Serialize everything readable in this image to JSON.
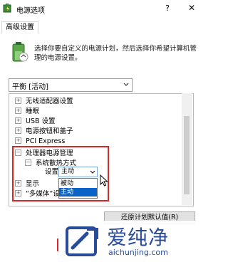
{
  "window": {
    "title": "电源选项",
    "help": "?",
    "close": "✕"
  },
  "tabs": [
    {
      "label": "高级设置"
    }
  ],
  "description": "选择你要自定义的电源计划，然后选择你希望计算机管理的电源设置。",
  "plan_select": {
    "value": "平衡 [活动]"
  },
  "tree": {
    "items": [
      {
        "expander": "+",
        "label": "无线适配器设置"
      },
      {
        "expander": "+",
        "label": "睡眠"
      },
      {
        "expander": "+",
        "label": "USB 设置"
      },
      {
        "expander": "+",
        "label": "电源按钮和盖子"
      },
      {
        "expander": "+",
        "label": "PCI Express"
      },
      {
        "expander": "−",
        "label": "处理器电源管理"
      },
      {
        "expander": "−",
        "label": "系统散热方式"
      },
      {
        "expander": "+",
        "label": "显示"
      },
      {
        "expander": "+",
        "label": "“多媒体”设置"
      }
    ],
    "setting_label": "设置:",
    "setting_value": "主动",
    "options": [
      "被动",
      "主动"
    ],
    "selected_option": "主动"
  },
  "buttons": {
    "restore": "还原计划默认值(R)"
  },
  "watermark": {
    "brand": "爱纯净",
    "url": "aichunjing.com"
  },
  "colors": {
    "accent": "#0a64c8",
    "highlight_border": "#d62828",
    "watermark": "#2a4b9a"
  }
}
